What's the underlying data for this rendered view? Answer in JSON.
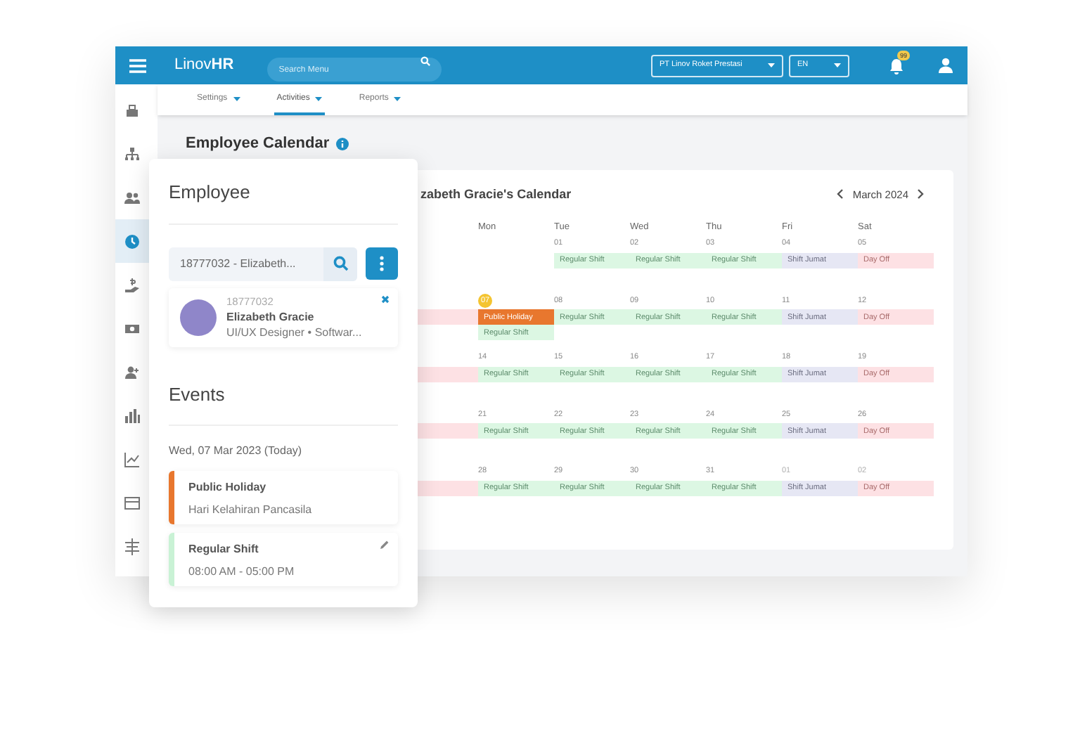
{
  "topbar": {
    "logo": "Linov**HR**",
    "search": {
      "placeholder": "Search Menu"
    },
    "company": "PT Linov Roket Prestasi",
    "language": "EN",
    "notifications": "99"
  },
  "tabs": [
    {
      "label": "Settings",
      "selected": false
    },
    {
      "label": "Activities",
      "selected": true
    },
    {
      "label": "Reports",
      "selected": false
    }
  ],
  "sidebar": {
    "items": [
      {
        "selected": false
      },
      {
        "selected": false
      },
      {
        "selected": false
      },
      {
        "selected": true
      },
      {
        "selected": false
      },
      {
        "selected": false
      },
      {
        "selected": false
      },
      {
        "selected": false
      },
      {
        "selected": false
      },
      {
        "selected": false
      },
      {
        "selected": false
      }
    ]
  },
  "page_title": "Employee Calendar",
  "calendar": {
    "title": "zabeth Gracie's Calendar",
    "month": "March 2024",
    "weekdays": [
      "Mon",
      "Tue",
      "Wed",
      "Thu",
      "Fri",
      "Sat"
    ],
    "weeks": [
      {
        "days": [
          {
            "date": "01",
            "events": [
              {
                "kind": "regular",
                "label": "Regular Shift"
              }
            ]
          },
          {
            "date": "02",
            "events": [
              {
                "kind": "regular",
                "label": "Regular Shift"
              }
            ]
          },
          {
            "date": "03",
            "events": [
              {
                "kind": "regular",
                "label": "Regular Shift"
              }
            ]
          },
          {
            "date": "04",
            "events": [
              {
                "kind": "jumat",
                "label": "Shift Jumat"
              }
            ]
          },
          {
            "date": "05",
            "events": [
              {
                "kind": "off",
                "label": "Day Off"
              }
            ]
          }
        ]
      },
      {
        "leading_day_off": true,
        "days": [
          {
            "date": "07",
            "today": true,
            "events": [
              {
                "kind": "holiday",
                "label": "Public Holiday"
              },
              {
                "kind": "regular",
                "label": "Regular Shift"
              }
            ]
          },
          {
            "date": "08",
            "events": [
              {
                "kind": "regular",
                "label": "Regular Shift"
              }
            ]
          },
          {
            "date": "09",
            "events": [
              {
                "kind": "regular",
                "label": "Regular Shift"
              }
            ]
          },
          {
            "date": "10",
            "events": [
              {
                "kind": "regular",
                "label": "Regular Shift"
              }
            ]
          },
          {
            "date": "11",
            "events": [
              {
                "kind": "jumat",
                "label": "Shift Jumat"
              }
            ]
          },
          {
            "date": "12",
            "events": [
              {
                "kind": "off",
                "label": "Day Off"
              }
            ]
          }
        ]
      },
      {
        "leading_day_off": true,
        "days": [
          {
            "date": "14",
            "events": [
              {
                "kind": "regular",
                "label": "Regular Shift"
              }
            ]
          },
          {
            "date": "15",
            "events": [
              {
                "kind": "regular",
                "label": "Regular Shift"
              }
            ]
          },
          {
            "date": "16",
            "events": [
              {
                "kind": "regular",
                "label": "Regular Shift"
              }
            ]
          },
          {
            "date": "17",
            "events": [
              {
                "kind": "regular",
                "label": "Regular Shift"
              }
            ]
          },
          {
            "date": "18",
            "events": [
              {
                "kind": "jumat",
                "label": "Shift Jumat"
              }
            ]
          },
          {
            "date": "19",
            "events": [
              {
                "kind": "off",
                "label": "Day Off"
              }
            ]
          }
        ]
      },
      {
        "leading_day_off": true,
        "days": [
          {
            "date": "21",
            "events": [
              {
                "kind": "regular",
                "label": "Regular Shift"
              }
            ]
          },
          {
            "date": "22",
            "events": [
              {
                "kind": "regular",
                "label": "Regular Shift"
              }
            ]
          },
          {
            "date": "23",
            "events": [
              {
                "kind": "regular",
                "label": "Regular Shift"
              }
            ]
          },
          {
            "date": "24",
            "events": [
              {
                "kind": "regular",
                "label": "Regular Shift"
              }
            ]
          },
          {
            "date": "25",
            "events": [
              {
                "kind": "jumat",
                "label": "Shift Jumat"
              }
            ]
          },
          {
            "date": "26",
            "events": [
              {
                "kind": "off",
                "label": "Day Off"
              }
            ]
          }
        ]
      },
      {
        "leading_day_off": true,
        "days": [
          {
            "date": "28",
            "events": [
              {
                "kind": "regular",
                "label": "Regular Shift"
              }
            ]
          },
          {
            "date": "29",
            "events": [
              {
                "kind": "regular",
                "label": "Regular Shift"
              }
            ]
          },
          {
            "date": "30",
            "events": [
              {
                "kind": "regular",
                "label": "Regular Shift"
              }
            ]
          },
          {
            "date": "31",
            "events": [
              {
                "kind": "regular",
                "label": "Regular Shift"
              }
            ]
          },
          {
            "date": "01",
            "outside": true,
            "events": [
              {
                "kind": "jumat",
                "label": "Shift Jumat"
              }
            ]
          },
          {
            "date": "02",
            "outside": true,
            "events": [
              {
                "kind": "off",
                "label": "Day Off"
              }
            ]
          }
        ]
      }
    ]
  },
  "employee_panel": {
    "title": "Employee",
    "search_value": "18777032 - Elizabeth...",
    "employee": {
      "id": "18777032",
      "name": "Elizabeth Gracie",
      "role": "UI/UX Designer • Softwar..."
    },
    "events_title": "Events",
    "date": "Wed, 07 Mar 2023 (Today)",
    "events": [
      {
        "kind": "holiday",
        "title": "Public Holiday",
        "detail": "Hari Kelahiran Pancasila",
        "editable": false
      },
      {
        "kind": "regular",
        "title": "Regular Shift",
        "detail": "08:00 AM - 05:00 PM",
        "editable": true
      }
    ]
  }
}
